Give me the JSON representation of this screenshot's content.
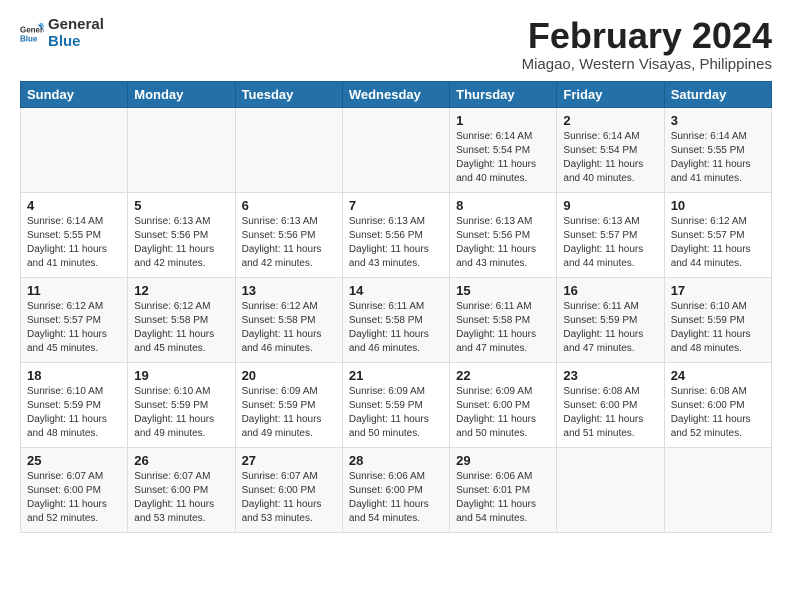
{
  "logo": {
    "line1": "General",
    "line2": "Blue"
  },
  "title": "February 2024",
  "subtitle": "Miagao, Western Visayas, Philippines",
  "headers": [
    "Sunday",
    "Monday",
    "Tuesday",
    "Wednesday",
    "Thursday",
    "Friday",
    "Saturday"
  ],
  "weeks": [
    [
      {
        "day": "",
        "text": ""
      },
      {
        "day": "",
        "text": ""
      },
      {
        "day": "",
        "text": ""
      },
      {
        "day": "",
        "text": ""
      },
      {
        "day": "1",
        "text": "Sunrise: 6:14 AM\nSunset: 5:54 PM\nDaylight: 11 hours\nand 40 minutes."
      },
      {
        "day": "2",
        "text": "Sunrise: 6:14 AM\nSunset: 5:54 PM\nDaylight: 11 hours\nand 40 minutes."
      },
      {
        "day": "3",
        "text": "Sunrise: 6:14 AM\nSunset: 5:55 PM\nDaylight: 11 hours\nand 41 minutes."
      }
    ],
    [
      {
        "day": "4",
        "text": "Sunrise: 6:14 AM\nSunset: 5:55 PM\nDaylight: 11 hours\nand 41 minutes."
      },
      {
        "day": "5",
        "text": "Sunrise: 6:13 AM\nSunset: 5:56 PM\nDaylight: 11 hours\nand 42 minutes."
      },
      {
        "day": "6",
        "text": "Sunrise: 6:13 AM\nSunset: 5:56 PM\nDaylight: 11 hours\nand 42 minutes."
      },
      {
        "day": "7",
        "text": "Sunrise: 6:13 AM\nSunset: 5:56 PM\nDaylight: 11 hours\nand 43 minutes."
      },
      {
        "day": "8",
        "text": "Sunrise: 6:13 AM\nSunset: 5:56 PM\nDaylight: 11 hours\nand 43 minutes."
      },
      {
        "day": "9",
        "text": "Sunrise: 6:13 AM\nSunset: 5:57 PM\nDaylight: 11 hours\nand 44 minutes."
      },
      {
        "day": "10",
        "text": "Sunrise: 6:12 AM\nSunset: 5:57 PM\nDaylight: 11 hours\nand 44 minutes."
      }
    ],
    [
      {
        "day": "11",
        "text": "Sunrise: 6:12 AM\nSunset: 5:57 PM\nDaylight: 11 hours\nand 45 minutes."
      },
      {
        "day": "12",
        "text": "Sunrise: 6:12 AM\nSunset: 5:58 PM\nDaylight: 11 hours\nand 45 minutes."
      },
      {
        "day": "13",
        "text": "Sunrise: 6:12 AM\nSunset: 5:58 PM\nDaylight: 11 hours\nand 46 minutes."
      },
      {
        "day": "14",
        "text": "Sunrise: 6:11 AM\nSunset: 5:58 PM\nDaylight: 11 hours\nand 46 minutes."
      },
      {
        "day": "15",
        "text": "Sunrise: 6:11 AM\nSunset: 5:58 PM\nDaylight: 11 hours\nand 47 minutes."
      },
      {
        "day": "16",
        "text": "Sunrise: 6:11 AM\nSunset: 5:59 PM\nDaylight: 11 hours\nand 47 minutes."
      },
      {
        "day": "17",
        "text": "Sunrise: 6:10 AM\nSunset: 5:59 PM\nDaylight: 11 hours\nand 48 minutes."
      }
    ],
    [
      {
        "day": "18",
        "text": "Sunrise: 6:10 AM\nSunset: 5:59 PM\nDaylight: 11 hours\nand 48 minutes."
      },
      {
        "day": "19",
        "text": "Sunrise: 6:10 AM\nSunset: 5:59 PM\nDaylight: 11 hours\nand 49 minutes."
      },
      {
        "day": "20",
        "text": "Sunrise: 6:09 AM\nSunset: 5:59 PM\nDaylight: 11 hours\nand 49 minutes."
      },
      {
        "day": "21",
        "text": "Sunrise: 6:09 AM\nSunset: 5:59 PM\nDaylight: 11 hours\nand 50 minutes."
      },
      {
        "day": "22",
        "text": "Sunrise: 6:09 AM\nSunset: 6:00 PM\nDaylight: 11 hours\nand 50 minutes."
      },
      {
        "day": "23",
        "text": "Sunrise: 6:08 AM\nSunset: 6:00 PM\nDaylight: 11 hours\nand 51 minutes."
      },
      {
        "day": "24",
        "text": "Sunrise: 6:08 AM\nSunset: 6:00 PM\nDaylight: 11 hours\nand 52 minutes."
      }
    ],
    [
      {
        "day": "25",
        "text": "Sunrise: 6:07 AM\nSunset: 6:00 PM\nDaylight: 11 hours\nand 52 minutes."
      },
      {
        "day": "26",
        "text": "Sunrise: 6:07 AM\nSunset: 6:00 PM\nDaylight: 11 hours\nand 53 minutes."
      },
      {
        "day": "27",
        "text": "Sunrise: 6:07 AM\nSunset: 6:00 PM\nDaylight: 11 hours\nand 53 minutes."
      },
      {
        "day": "28",
        "text": "Sunrise: 6:06 AM\nSunset: 6:00 PM\nDaylight: 11 hours\nand 54 minutes."
      },
      {
        "day": "29",
        "text": "Sunrise: 6:06 AM\nSunset: 6:01 PM\nDaylight: 11 hours\nand 54 minutes."
      },
      {
        "day": "",
        "text": ""
      },
      {
        "day": "",
        "text": ""
      }
    ]
  ]
}
